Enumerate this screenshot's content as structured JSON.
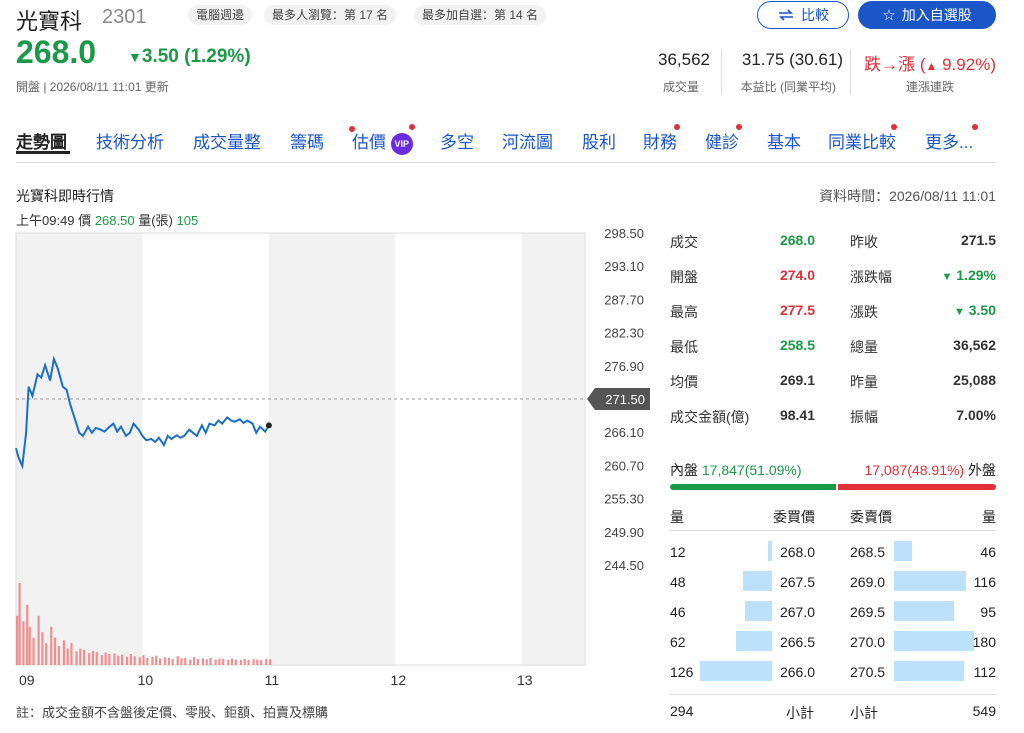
{
  "stock": {
    "name": "光寶科",
    "code": "2301"
  },
  "tags": [
    "電腦週邊",
    "最多人瀏覽：第 17 名",
    "最多加自選：第 14 名"
  ],
  "buttons": {
    "compare": "比較",
    "add_watch": "加入自選股"
  },
  "price": {
    "value": "268.0",
    "change": "3.50 (1.29%)",
    "sub": "開盤 | 2026/08/11 11:01 更新"
  },
  "stats": {
    "volume": {
      "value": "36,562",
      "label": "成交量"
    },
    "pe": {
      "value": "31.75 (30.61)",
      "label": "本益比 (同業平均)"
    },
    "streak": {
      "value_prefix": "跌→漲 (",
      "value_pct": "9.92%)",
      "label": "連漲連跌"
    }
  },
  "nav": [
    "走勢圖",
    "技術分析",
    "成交量整",
    "籌碼",
    "估價",
    "多空",
    "河流圖",
    "股利",
    "財務",
    "健診",
    "基本",
    "同業比較",
    "更多..."
  ],
  "nav_vip": "VIP",
  "section": {
    "title": "光寶科即時行情",
    "time": "資料時間：2026/08/11 11:01",
    "cur_time": "上午09:49",
    "cur_price_label": "價",
    "cur_price": "268.50",
    "cur_vol_label": "量(張)",
    "cur_vol": "105"
  },
  "chart_data": {
    "type": "line",
    "x_ticks": [
      "09",
      "10",
      "11",
      "12",
      "13"
    ],
    "y_ticks": [
      "298.50",
      "293.10",
      "287.70",
      "282.30",
      "276.90",
      "271.50",
      "266.10",
      "260.70",
      "255.30",
      "249.90",
      "244.50"
    ],
    "ylim": [
      244.5,
      298.5
    ],
    "xlim": [
      9.0,
      13.5
    ],
    "ref_price": 271.5,
    "ref_label": "271.50",
    "series": [
      {
        "x": [
          9.0,
          9.02,
          9.05,
          9.08,
          9.1,
          9.13,
          9.17,
          9.2,
          9.23,
          9.27,
          9.3,
          9.33,
          9.37,
          9.4,
          9.43,
          9.47,
          9.5,
          9.53,
          9.57,
          9.6,
          9.63,
          9.67,
          9.7,
          9.73,
          9.77,
          9.8,
          9.83,
          9.87,
          9.9,
          9.93,
          9.97,
          10.0,
          10.03,
          10.07,
          10.1,
          10.13,
          10.17,
          10.2,
          10.23,
          10.27,
          10.3,
          10.33,
          10.37,
          10.4,
          10.43,
          10.47,
          10.5,
          10.53,
          10.57,
          10.6,
          10.63,
          10.67,
          10.7,
          10.73,
          10.77,
          10.8,
          10.83,
          10.87,
          10.9,
          10.93,
          10.97,
          11.0
        ],
        "y": [
          263.5,
          262.0,
          260.6,
          266.0,
          273.5,
          272.0,
          275.5,
          275.0,
          277.0,
          274.5,
          278.0,
          276.5,
          273.5,
          273.0,
          270.5,
          268.0,
          266.0,
          265.5,
          267.0,
          266.0,
          266.8,
          266.5,
          266.2,
          266.8,
          267.5,
          266.2,
          267.0,
          265.5,
          266.0,
          267.5,
          266.5,
          265.5,
          264.8,
          265.0,
          264.5,
          265.2,
          264.0,
          265.5,
          265.0,
          265.6,
          265.2,
          265.5,
          266.5,
          266.0,
          265.5,
          267.2,
          266.0,
          267.5,
          267.2,
          268.0,
          267.5,
          268.5,
          268.0,
          267.8,
          268.2,
          267.6,
          268.0,
          267.5,
          266.0,
          267.0,
          266.2,
          267.2
        ]
      }
    ],
    "volume": {
      "values": [
        900,
        1500,
        800,
        1100,
        700,
        500,
        900,
        600,
        400,
        700,
        500,
        350,
        450,
        300,
        400,
        250,
        300,
        280,
        220,
        260,
        240,
        180,
        230,
        200,
        210,
        170,
        190,
        150,
        200,
        160,
        140,
        180,
        130,
        150,
        170,
        120,
        140,
        130,
        110,
        160,
        120,
        130,
        100,
        140,
        110,
        120,
        105,
        130,
        100,
        115,
        110,
        95,
        120,
        100,
        90,
        110,
        95,
        105,
        100,
        90,
        110,
        105
      ]
    }
  },
  "quote": [
    {
      "l1": "成交",
      "v1": "268.0",
      "c1": "g",
      "l2": "昨收",
      "v2": "271.5",
      "c2": ""
    },
    {
      "l1": "開盤",
      "v1": "274.0",
      "c1": "r",
      "l2": "漲跌幅",
      "v2": "1.29%",
      "c2": "g",
      "arrow2": "▼"
    },
    {
      "l1": "最高",
      "v1": "277.5",
      "c1": "r",
      "l2": "漲跌",
      "v2": "3.50",
      "c2": "g",
      "arrow2": "▼"
    },
    {
      "l1": "最低",
      "v1": "258.5",
      "c1": "g",
      "l2": "總量",
      "v2": "36,562",
      "c2": ""
    },
    {
      "l1": "均價",
      "v1": "269.1",
      "c1": "",
      "l2": "昨量",
      "v2": "25,088",
      "c2": ""
    },
    {
      "l1": "成交金額(億)",
      "v1": "98.41",
      "c1": "",
      "l2": "振幅",
      "v2": "7.00%",
      "c2": ""
    }
  ],
  "inout": {
    "in_label": "內盤",
    "in_value": "17,847(51.09%)",
    "out_value": "17,087(48.91%)",
    "out_label": "外盤",
    "in_ratio": 0.5109
  },
  "orderbook": {
    "headers": {
      "qty": "量",
      "bid": "委買價",
      "ask": "委賣價",
      "qty2": "量"
    },
    "rows": [
      {
        "bq": "12",
        "bp": "268.0",
        "ap": "268.5",
        "aq": "46",
        "bfrac": 0.05,
        "afrac": 0.22
      },
      {
        "bq": "48",
        "bp": "267.5",
        "ap": "269.0",
        "aq": "116",
        "bfrac": 0.4,
        "afrac": 0.9
      },
      {
        "bq": "46",
        "bp": "267.0",
        "ap": "269.5",
        "aq": "95",
        "bfrac": 0.38,
        "afrac": 0.75
      },
      {
        "bq": "62",
        "bp": "266.5",
        "ap": "270.0",
        "aq": "180",
        "bfrac": 0.5,
        "afrac": 1.0
      },
      {
        "bq": "126",
        "bp": "266.0",
        "ap": "270.5",
        "aq": "112",
        "bfrac": 1.0,
        "afrac": 0.88
      }
    ],
    "total": {
      "bq": "294",
      "label": "小計",
      "label2": "小計",
      "aq": "549"
    }
  },
  "footer": "註：成交金額不含盤後定價、零股、鉅額、拍賣及標購"
}
